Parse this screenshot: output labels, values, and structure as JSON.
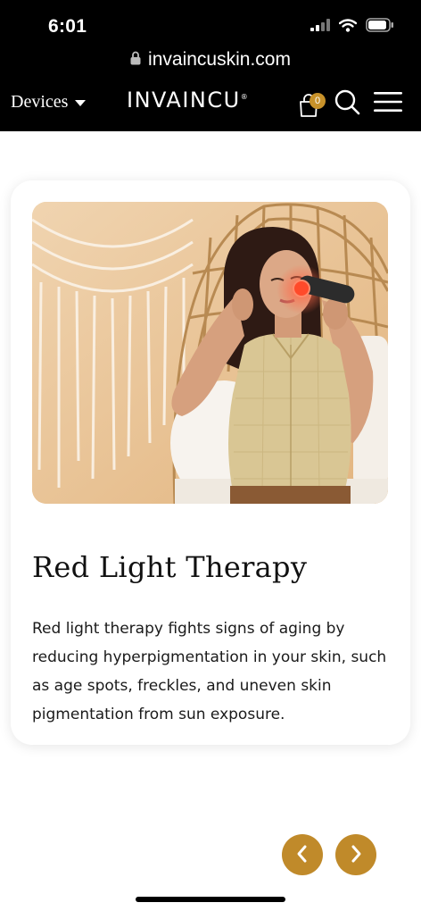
{
  "status": {
    "time": "6:01"
  },
  "browser": {
    "url": "invaincuskin.com"
  },
  "header": {
    "menu_label": "Devices",
    "logo": "INVAINCU",
    "logo_mark": "®",
    "cart_count": "0"
  },
  "card": {
    "title": "Red Light Therapy",
    "description": "Red light therapy fights signs of aging by reducing hyperpigmentation in your skin, such as age spots, freckles, and uneven skin pigmentation from sun exposure."
  },
  "colors": {
    "accent": "#c08a2a",
    "header_bg": "#000000",
    "background": "#ffffff"
  },
  "icons": [
    "signal-icon",
    "wifi-icon",
    "battery-icon",
    "lock-icon",
    "chevron-down-icon",
    "cart-icon",
    "search-icon",
    "menu-icon",
    "chevron-left-icon",
    "chevron-right-icon"
  ]
}
